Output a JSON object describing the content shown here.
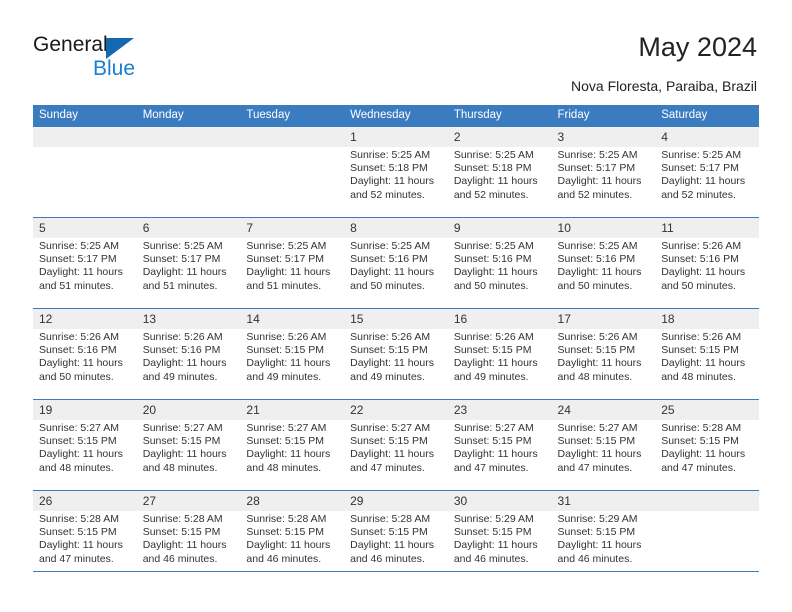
{
  "brand": {
    "name_line1": "General",
    "name_line2": "Blue",
    "triangle_color": "#1667b2",
    "blue_text_color": "#1a7fd4"
  },
  "header": {
    "title": "May 2024",
    "location": "Nova Floresta, Paraiba, Brazil",
    "header_bg": "#3b7cc0",
    "numrow_bg": "#efefef"
  },
  "weekdays": [
    "Sunday",
    "Monday",
    "Tuesday",
    "Wednesday",
    "Thursday",
    "Friday",
    "Saturday"
  ],
  "weeks": [
    [
      {
        "day": "",
        "sunrise": "",
        "sunset": "",
        "daylight1": "",
        "daylight2": ""
      },
      {
        "day": "",
        "sunrise": "",
        "sunset": "",
        "daylight1": "",
        "daylight2": ""
      },
      {
        "day": "",
        "sunrise": "",
        "sunset": "",
        "daylight1": "",
        "daylight2": ""
      },
      {
        "day": "1",
        "sunrise": "Sunrise: 5:25 AM",
        "sunset": "Sunset: 5:18 PM",
        "daylight1": "Daylight: 11 hours",
        "daylight2": "and 52 minutes."
      },
      {
        "day": "2",
        "sunrise": "Sunrise: 5:25 AM",
        "sunset": "Sunset: 5:18 PM",
        "daylight1": "Daylight: 11 hours",
        "daylight2": "and 52 minutes."
      },
      {
        "day": "3",
        "sunrise": "Sunrise: 5:25 AM",
        "sunset": "Sunset: 5:17 PM",
        "daylight1": "Daylight: 11 hours",
        "daylight2": "and 52 minutes."
      },
      {
        "day": "4",
        "sunrise": "Sunrise: 5:25 AM",
        "sunset": "Sunset: 5:17 PM",
        "daylight1": "Daylight: 11 hours",
        "daylight2": "and 52 minutes."
      }
    ],
    [
      {
        "day": "5",
        "sunrise": "Sunrise: 5:25 AM",
        "sunset": "Sunset: 5:17 PM",
        "daylight1": "Daylight: 11 hours",
        "daylight2": "and 51 minutes."
      },
      {
        "day": "6",
        "sunrise": "Sunrise: 5:25 AM",
        "sunset": "Sunset: 5:17 PM",
        "daylight1": "Daylight: 11 hours",
        "daylight2": "and 51 minutes."
      },
      {
        "day": "7",
        "sunrise": "Sunrise: 5:25 AM",
        "sunset": "Sunset: 5:17 PM",
        "daylight1": "Daylight: 11 hours",
        "daylight2": "and 51 minutes."
      },
      {
        "day": "8",
        "sunrise": "Sunrise: 5:25 AM",
        "sunset": "Sunset: 5:16 PM",
        "daylight1": "Daylight: 11 hours",
        "daylight2": "and 50 minutes."
      },
      {
        "day": "9",
        "sunrise": "Sunrise: 5:25 AM",
        "sunset": "Sunset: 5:16 PM",
        "daylight1": "Daylight: 11 hours",
        "daylight2": "and 50 minutes."
      },
      {
        "day": "10",
        "sunrise": "Sunrise: 5:25 AM",
        "sunset": "Sunset: 5:16 PM",
        "daylight1": "Daylight: 11 hours",
        "daylight2": "and 50 minutes."
      },
      {
        "day": "11",
        "sunrise": "Sunrise: 5:26 AM",
        "sunset": "Sunset: 5:16 PM",
        "daylight1": "Daylight: 11 hours",
        "daylight2": "and 50 minutes."
      }
    ],
    [
      {
        "day": "12",
        "sunrise": "Sunrise: 5:26 AM",
        "sunset": "Sunset: 5:16 PM",
        "daylight1": "Daylight: 11 hours",
        "daylight2": "and 50 minutes."
      },
      {
        "day": "13",
        "sunrise": "Sunrise: 5:26 AM",
        "sunset": "Sunset: 5:16 PM",
        "daylight1": "Daylight: 11 hours",
        "daylight2": "and 49 minutes."
      },
      {
        "day": "14",
        "sunrise": "Sunrise: 5:26 AM",
        "sunset": "Sunset: 5:15 PM",
        "daylight1": "Daylight: 11 hours",
        "daylight2": "and 49 minutes."
      },
      {
        "day": "15",
        "sunrise": "Sunrise: 5:26 AM",
        "sunset": "Sunset: 5:15 PM",
        "daylight1": "Daylight: 11 hours",
        "daylight2": "and 49 minutes."
      },
      {
        "day": "16",
        "sunrise": "Sunrise: 5:26 AM",
        "sunset": "Sunset: 5:15 PM",
        "daylight1": "Daylight: 11 hours",
        "daylight2": "and 49 minutes."
      },
      {
        "day": "17",
        "sunrise": "Sunrise: 5:26 AM",
        "sunset": "Sunset: 5:15 PM",
        "daylight1": "Daylight: 11 hours",
        "daylight2": "and 48 minutes."
      },
      {
        "day": "18",
        "sunrise": "Sunrise: 5:26 AM",
        "sunset": "Sunset: 5:15 PM",
        "daylight1": "Daylight: 11 hours",
        "daylight2": "and 48 minutes."
      }
    ],
    [
      {
        "day": "19",
        "sunrise": "Sunrise: 5:27 AM",
        "sunset": "Sunset: 5:15 PM",
        "daylight1": "Daylight: 11 hours",
        "daylight2": "and 48 minutes."
      },
      {
        "day": "20",
        "sunrise": "Sunrise: 5:27 AM",
        "sunset": "Sunset: 5:15 PM",
        "daylight1": "Daylight: 11 hours",
        "daylight2": "and 48 minutes."
      },
      {
        "day": "21",
        "sunrise": "Sunrise: 5:27 AM",
        "sunset": "Sunset: 5:15 PM",
        "daylight1": "Daylight: 11 hours",
        "daylight2": "and 48 minutes."
      },
      {
        "day": "22",
        "sunrise": "Sunrise: 5:27 AM",
        "sunset": "Sunset: 5:15 PM",
        "daylight1": "Daylight: 11 hours",
        "daylight2": "and 47 minutes."
      },
      {
        "day": "23",
        "sunrise": "Sunrise: 5:27 AM",
        "sunset": "Sunset: 5:15 PM",
        "daylight1": "Daylight: 11 hours",
        "daylight2": "and 47 minutes."
      },
      {
        "day": "24",
        "sunrise": "Sunrise: 5:27 AM",
        "sunset": "Sunset: 5:15 PM",
        "daylight1": "Daylight: 11 hours",
        "daylight2": "and 47 minutes."
      },
      {
        "day": "25",
        "sunrise": "Sunrise: 5:28 AM",
        "sunset": "Sunset: 5:15 PM",
        "daylight1": "Daylight: 11 hours",
        "daylight2": "and 47 minutes."
      }
    ],
    [
      {
        "day": "26",
        "sunrise": "Sunrise: 5:28 AM",
        "sunset": "Sunset: 5:15 PM",
        "daylight1": "Daylight: 11 hours",
        "daylight2": "and 47 minutes."
      },
      {
        "day": "27",
        "sunrise": "Sunrise: 5:28 AM",
        "sunset": "Sunset: 5:15 PM",
        "daylight1": "Daylight: 11 hours",
        "daylight2": "and 46 minutes."
      },
      {
        "day": "28",
        "sunrise": "Sunrise: 5:28 AM",
        "sunset": "Sunset: 5:15 PM",
        "daylight1": "Daylight: 11 hours",
        "daylight2": "and 46 minutes."
      },
      {
        "day": "29",
        "sunrise": "Sunrise: 5:28 AM",
        "sunset": "Sunset: 5:15 PM",
        "daylight1": "Daylight: 11 hours",
        "daylight2": "and 46 minutes."
      },
      {
        "day": "30",
        "sunrise": "Sunrise: 5:29 AM",
        "sunset": "Sunset: 5:15 PM",
        "daylight1": "Daylight: 11 hours",
        "daylight2": "and 46 minutes."
      },
      {
        "day": "31",
        "sunrise": "Sunrise: 5:29 AM",
        "sunset": "Sunset: 5:15 PM",
        "daylight1": "Daylight: 11 hours",
        "daylight2": "and 46 minutes."
      },
      {
        "day": "",
        "sunrise": "",
        "sunset": "",
        "daylight1": "",
        "daylight2": ""
      }
    ]
  ]
}
